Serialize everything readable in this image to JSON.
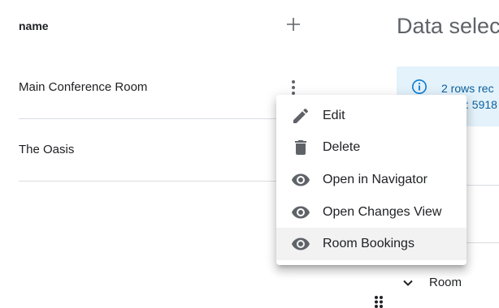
{
  "table": {
    "column_header": "name",
    "rows": [
      {
        "name": "Main Conference Room"
      },
      {
        "name": "The Oasis"
      }
    ]
  },
  "panel": {
    "title": "Data selec",
    "info_line1": "2 rows rec",
    "info_line2": ": 5918",
    "room_filter_label": "Room"
  },
  "context_menu": {
    "items": [
      {
        "label": "Edit",
        "icon": "pencil-icon"
      },
      {
        "label": "Delete",
        "icon": "trash-icon"
      },
      {
        "label": "Open in Navigator",
        "icon": "eye-icon"
      },
      {
        "label": "Open Changes View",
        "icon": "eye-icon"
      },
      {
        "label": "Room Bookings",
        "icon": "eye-icon"
      }
    ],
    "hovered_item": "Room Bookings"
  },
  "colors": {
    "info_background": "#e3f2fb",
    "info_text": "#0b5f9c",
    "icon_gray": "#5f6368",
    "divider": "#dadce0"
  }
}
